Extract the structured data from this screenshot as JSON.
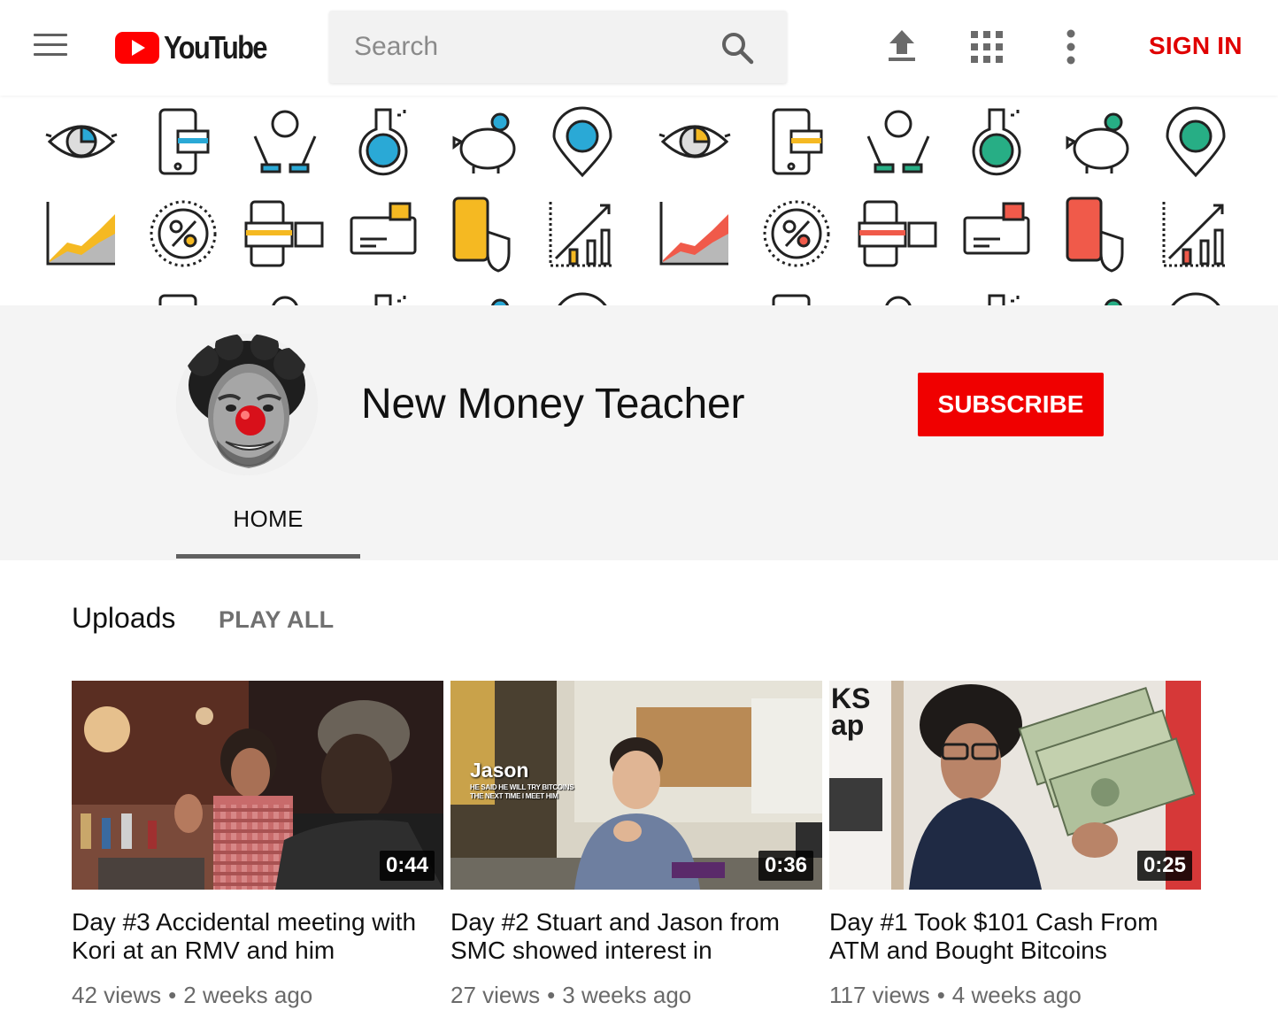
{
  "masthead": {
    "logo_text": "YouTube",
    "search_placeholder": "Search",
    "sign_in_label": "SIGN IN",
    "icons": [
      "menu-icon",
      "youtube-logo",
      "search-icon",
      "upload-icon",
      "apps-grid-icon",
      "more-vert-icon"
    ]
  },
  "channel": {
    "name": "New Money Teacher",
    "subscribe_label": "SUBSCRIBE",
    "tabs": [
      {
        "label": "HOME",
        "active": true
      }
    ]
  },
  "uploads": {
    "title": "Uploads",
    "play_all_label": "PLAY ALL",
    "videos": [
      {
        "title": "Day #3 Accidental meeting with Kori at an RMV and him",
        "views": "42 views",
        "age": "2 weeks ago",
        "duration": "0:44"
      },
      {
        "title": "Day #2 Stuart and Jason from SMC showed interest in",
        "views": "27 views",
        "age": "3 weeks ago",
        "duration": "0:36",
        "thumb_caption": "Jason",
        "thumb_subcaption_1": "HE SAID HE WILL TRY BITCOINS",
        "thumb_subcaption_2": "THE NEXT TIME I MEET HIM"
      },
      {
        "title": "Day #1 Took $101 Cash From ATM and Bought Bitcoins",
        "views": "117 views",
        "age": "4 weeks ago",
        "duration": "0:25",
        "thumb_sign_1": "KS",
        "thumb_sign_2": "ap"
      }
    ]
  },
  "colors": {
    "brand_red": "#ff0000",
    "sign_in_red": "#e00000",
    "subscribe_red": "#f00000",
    "header_bg": "#f4f4f4",
    "banner_accent_blue": "#2aa9d6",
    "banner_accent_yellow": "#f5b922",
    "banner_accent_green": "#27ae85",
    "banner_accent_red": "#f05a4a"
  }
}
